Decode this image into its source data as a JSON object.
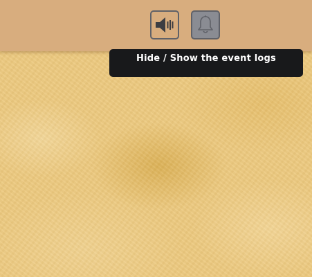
{
  "topbar": {
    "sound_button": {
      "icon": "speaker-volume-icon",
      "color": "#3c3d42"
    },
    "events_button": {
      "icon": "bell-icon",
      "color": "#5f6168",
      "state": "active"
    }
  },
  "tooltip": {
    "text": "Hide / Show the event logs"
  },
  "colors": {
    "topbar": "#d8ad7e",
    "background": "#ecc97f",
    "tooltip_bg": "#18191b",
    "active_button_bg": "#8a8c93"
  }
}
